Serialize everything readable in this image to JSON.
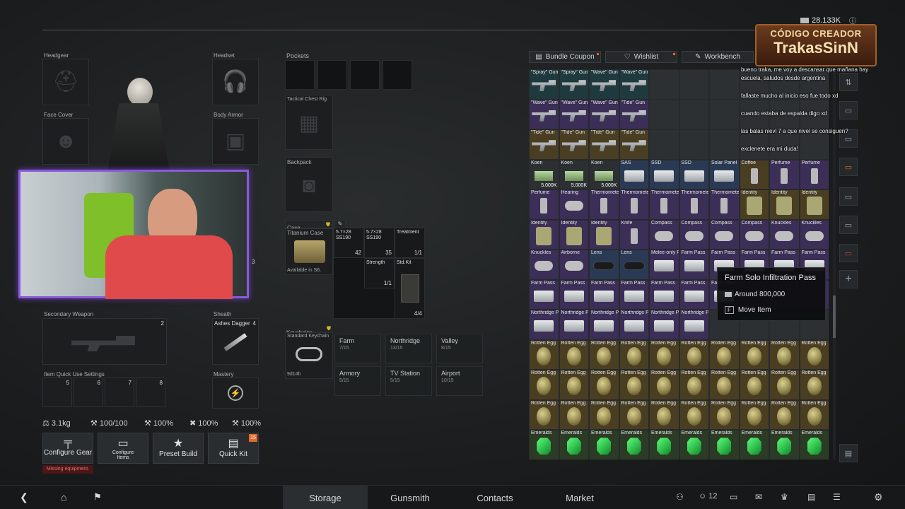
{
  "currency": {
    "amount": "28.133K"
  },
  "overlay": {
    "creator_line1": "CÓDIGO CREADOR",
    "creator_line2": "TrakasSinN"
  },
  "chat": [
    "bueno traka, me voy a descansar que mañana hay",
    "escuela, saludos desde argentina",
    "fallaste mucho al inicio eso fue todo xd",
    "cuando estaba de espalda digo xd",
    "las balas nievl 7 a que nivel se consiguen?",
    "exclenete era mi duda!"
  ],
  "gear": {
    "headgear": "Headgear",
    "headset": "Headset",
    "face_cover": "Face Cover",
    "body_armor": "Body Armor",
    "secondary_weapon": "Secondary Weapon",
    "secondary_num": "2",
    "sheath": "Sheath",
    "sheath_item": "Ashes Dagger",
    "sheath_num": "4",
    "quick_use": "Item Quick Use Settings",
    "quick_slots": [
      "5",
      "6",
      "7",
      "8"
    ],
    "mastery": "Mastery",
    "primary_num": "3"
  },
  "stats": {
    "weight": "3.1kg",
    "durability": "100/100",
    "stat2": "100%",
    "stat3": "100%",
    "stat4": "100%"
  },
  "actions": {
    "configure_gear": "Configure Gear",
    "missing": "Missing equipment.",
    "configure_items": "Configure Items",
    "preset_build": "Preset Build",
    "quick_kit": "Quick Kit",
    "quick_kit_badge": "15"
  },
  "containers": {
    "pockets": "Pockets",
    "tactical": "Tactical Chest Rig",
    "backpack": "Backpack",
    "case": "Case",
    "case_item": "Titanium Case",
    "case_status": "Available in S6.",
    "case_items": [
      {
        "label": "5.7×28 SS190",
        "count": "42"
      },
      {
        "label": "5.7×28 SS190",
        "count": "35"
      },
      {
        "label": "Treatment",
        "count": "1/1"
      },
      {
        "label": "Strength",
        "count": "1/1"
      },
      {
        "label": "Std.Kit",
        "count": "4/4"
      }
    ],
    "keychains": "Keychains",
    "keychain_item": "Standard Keychain",
    "keychain_time": "9d14h",
    "keys": [
      {
        "name": "Farm",
        "count": "7/15"
      },
      {
        "name": "Northridge",
        "count": "13/15"
      },
      {
        "name": "Valley",
        "count": "8/15"
      },
      {
        "name": "Armory",
        "count": "5/15"
      },
      {
        "name": "TV Station",
        "count": "5/15"
      },
      {
        "name": "Airport",
        "count": "10/15"
      }
    ]
  },
  "storage_tabs": [
    {
      "label": "Bundle Coupon",
      "icon": "coupon-icon"
    },
    {
      "label": "Wishlist",
      "icon": "heart-icon"
    },
    {
      "label": "Workbench",
      "icon": "wrench-icon"
    }
  ],
  "grid_rows": [
    {
      "bg": "teal",
      "items": [
        "\"Spray\" Gun",
        "\"Spray\" Gun",
        "\"Wave\" Gun",
        "\"Wave\" Gun",
        "",
        "",
        "",
        "",
        "",
        ""
      ],
      "kind": "gun"
    },
    {
      "bg": "purple",
      "items": [
        "\"Wave\" Gun",
        "\"Wave\" Gun",
        "\"Wave\" Gun",
        "\"Tide\" Gun",
        "",
        "",
        "",
        "",
        "",
        ""
      ],
      "kind": "gun"
    },
    {
      "bg": "gold",
      "items": [
        "\"Tide\" Gun",
        "\"Tide\" Gun",
        "\"Tide\" Gun",
        "\"Tide\" Gun",
        "",
        "",
        "",
        "",
        "",
        ""
      ],
      "kind": "gun"
    }
  ],
  "row4": [
    {
      "label": "Koen",
      "count": "5.000K",
      "bg": "grey",
      "kind": "cash"
    },
    {
      "label": "Koen",
      "count": "5.000K",
      "bg": "grey",
      "kind": "cash"
    },
    {
      "label": "Koen",
      "count": "5.000K",
      "bg": "grey",
      "kind": "cash"
    },
    {
      "label": "SAS",
      "count": "",
      "bg": "blue",
      "kind": "card"
    },
    {
      "label": "SSD",
      "count": "",
      "bg": "blue",
      "kind": "card"
    },
    {
      "label": "SSD",
      "count": "",
      "bg": "blue",
      "kind": "card"
    },
    {
      "label": "Solar Panel",
      "count": "",
      "bg": "blue",
      "kind": "card"
    },
    {
      "label": "Coffee",
      "count": "",
      "bg": "gold",
      "kind": "bottle"
    },
    {
      "label": "Perfume",
      "count": "",
      "bg": "purple",
      "kind": "bottle"
    },
    {
      "label": "Perfume",
      "count": "",
      "bg": "purple",
      "kind": "bottle"
    }
  ],
  "row5": [
    {
      "label": "Perfume",
      "bg": "purple",
      "kind": "bottle"
    },
    {
      "label": "Hearing",
      "bg": "purple",
      "kind": "knuckles"
    },
    {
      "label": "Thermometer",
      "bg": "purple",
      "kind": "bottle"
    },
    {
      "label": "Thermometer",
      "bg": "purple",
      "kind": "bottle"
    },
    {
      "label": "Thermometer",
      "bg": "purple",
      "kind": "bottle"
    },
    {
      "label": "Thermometer",
      "bg": "purple",
      "kind": "bottle"
    },
    {
      "label": "Thermometer",
      "bg": "purple",
      "kind": "bottle"
    },
    {
      "label": "Identity",
      "bg": "gold",
      "kind": "idcard"
    },
    {
      "label": "Identity",
      "bg": "gold",
      "kind": "idcard"
    },
    {
      "label": "Identity",
      "bg": "gold",
      "kind": "idcard"
    }
  ],
  "row6": [
    {
      "label": "Identity",
      "bg": "purple",
      "kind": "idcard"
    },
    {
      "label": "Identity",
      "bg": "purple",
      "kind": "idcard"
    },
    {
      "label": "Identity",
      "bg": "purple",
      "kind": "idcard"
    },
    {
      "label": "Knife",
      "bg": "purple",
      "kind": "bottle"
    },
    {
      "label": "Compass",
      "bg": "purple",
      "kind": "knuckles"
    },
    {
      "label": "Compass",
      "bg": "purple",
      "kind": "knuckles"
    },
    {
      "label": "Compass",
      "bg": "purple",
      "kind": "knuckles"
    },
    {
      "label": "Compass",
      "bg": "purple",
      "kind": "knuckles"
    },
    {
      "label": "Knuckles",
      "bg": "purple",
      "kind": "knuckles"
    },
    {
      "label": "Knuckles",
      "bg": "purple",
      "kind": "knuckles"
    }
  ],
  "row7": [
    {
      "label": "Knuckles",
      "bg": "purple",
      "kind": "knuckles"
    },
    {
      "label": "Airborne",
      "bg": "purple",
      "kind": "knuckles"
    },
    {
      "label": "Lens",
      "bg": "blue",
      "kind": "tube"
    },
    {
      "label": "Lens",
      "bg": "blue",
      "kind": "tube"
    },
    {
      "label": "Melee-only Pass",
      "bg": "purple",
      "kind": "card"
    },
    {
      "label": "Farm Pass",
      "bg": "purple",
      "kind": "card"
    },
    {
      "label": "Farm Pass",
      "bg": "purple",
      "kind": "card"
    },
    {
      "label": "Farm Pass",
      "bg": "purple",
      "kind": "card"
    },
    {
      "label": "Farm Pass",
      "bg": "purple",
      "kind": "card"
    },
    {
      "label": "Farm Pass",
      "bg": "purple",
      "kind": "card"
    }
  ],
  "row8": [
    "Farm Pass",
    "Farm Pass",
    "Farm Pass",
    "Farm Pass",
    "Farm Pass",
    "Farm Pass",
    "Farm Pass",
    "",
    "",
    ""
  ],
  "row9": [
    "Northridge Pass",
    "Northridge Pass",
    "Northridge Pass",
    "Northridge Pass",
    "Northridge Pass",
    "Northridge Pass",
    "",
    "",
    "",
    ""
  ],
  "egg_label": "Rotten Egg",
  "emerald_label": "Emeralds",
  "tooltip": {
    "title": "Farm Solo Infiltration Pass",
    "price": "Around 800,000",
    "key": "F",
    "action": "Move Item"
  },
  "nav": {
    "storage": "Storage",
    "gunsmith": "Gunsmith",
    "contacts": "Contacts",
    "market": "Market",
    "friends_count": "12"
  }
}
